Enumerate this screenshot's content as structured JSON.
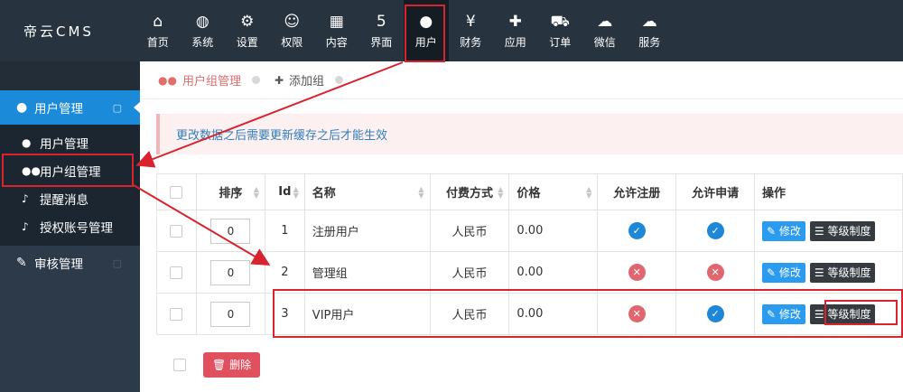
{
  "brand": "帝云CMS",
  "nav": [
    {
      "label": "首页",
      "icon": "home-icon",
      "glyph": "⌂"
    },
    {
      "label": "系统",
      "icon": "globe-icon",
      "glyph": "◍"
    },
    {
      "label": "设置",
      "icon": "gears-icon",
      "glyph": "⚙"
    },
    {
      "label": "权限",
      "icon": "user-circle-icon",
      "glyph": "☺"
    },
    {
      "label": "内容",
      "icon": "grid-icon",
      "glyph": "▦"
    },
    {
      "label": "界面",
      "icon": "html5-icon",
      "glyph": "5"
    },
    {
      "label": "用户",
      "icon": "user-icon",
      "glyph": "●"
    },
    {
      "label": "财务",
      "icon": "yen-icon",
      "glyph": "¥"
    },
    {
      "label": "应用",
      "icon": "puzzle-icon",
      "glyph": "✚"
    },
    {
      "label": "订单",
      "icon": "cart-icon",
      "glyph": "⛟"
    },
    {
      "label": "微信",
      "icon": "wechat-icon",
      "glyph": "☁"
    },
    {
      "label": "服务",
      "icon": "cloud-icon",
      "glyph": "☁"
    }
  ],
  "active_nav": "用户",
  "sidebar": {
    "group1": "用户管理",
    "items": [
      "用户管理",
      "用户组管理",
      "提醒消息",
      "授权账号管理"
    ],
    "group2": "审核管理"
  },
  "crumbs": {
    "current": "用户组管理",
    "add": "添加组"
  },
  "alert": "更改数据之后需要更新缓存之后才能生效",
  "table": {
    "headers": [
      "排序",
      "Id",
      "名称",
      "付费方式",
      "价格",
      "允许注册",
      "允许申请",
      "操作"
    ],
    "rows": [
      {
        "order": "0",
        "id": "1",
        "name": "注册用户",
        "pay": "人民币",
        "price": "0.00",
        "allow_reg": true,
        "allow_apply": true
      },
      {
        "order": "0",
        "id": "2",
        "name": "管理组",
        "pay": "人民币",
        "price": "0.00",
        "allow_reg": false,
        "allow_apply": false
      },
      {
        "order": "0",
        "id": "3",
        "name": "VIP用户",
        "pay": "人民币",
        "price": "0.00",
        "allow_reg": false,
        "allow_apply": true
      }
    ],
    "edit_label": "修改",
    "level_label": "等级制度"
  },
  "delete_label": "删除",
  "colors": {
    "accent": "#1b8ad9",
    "topbar": "#27333f",
    "annotation": "#d9232e",
    "danger": "#e0505f"
  }
}
